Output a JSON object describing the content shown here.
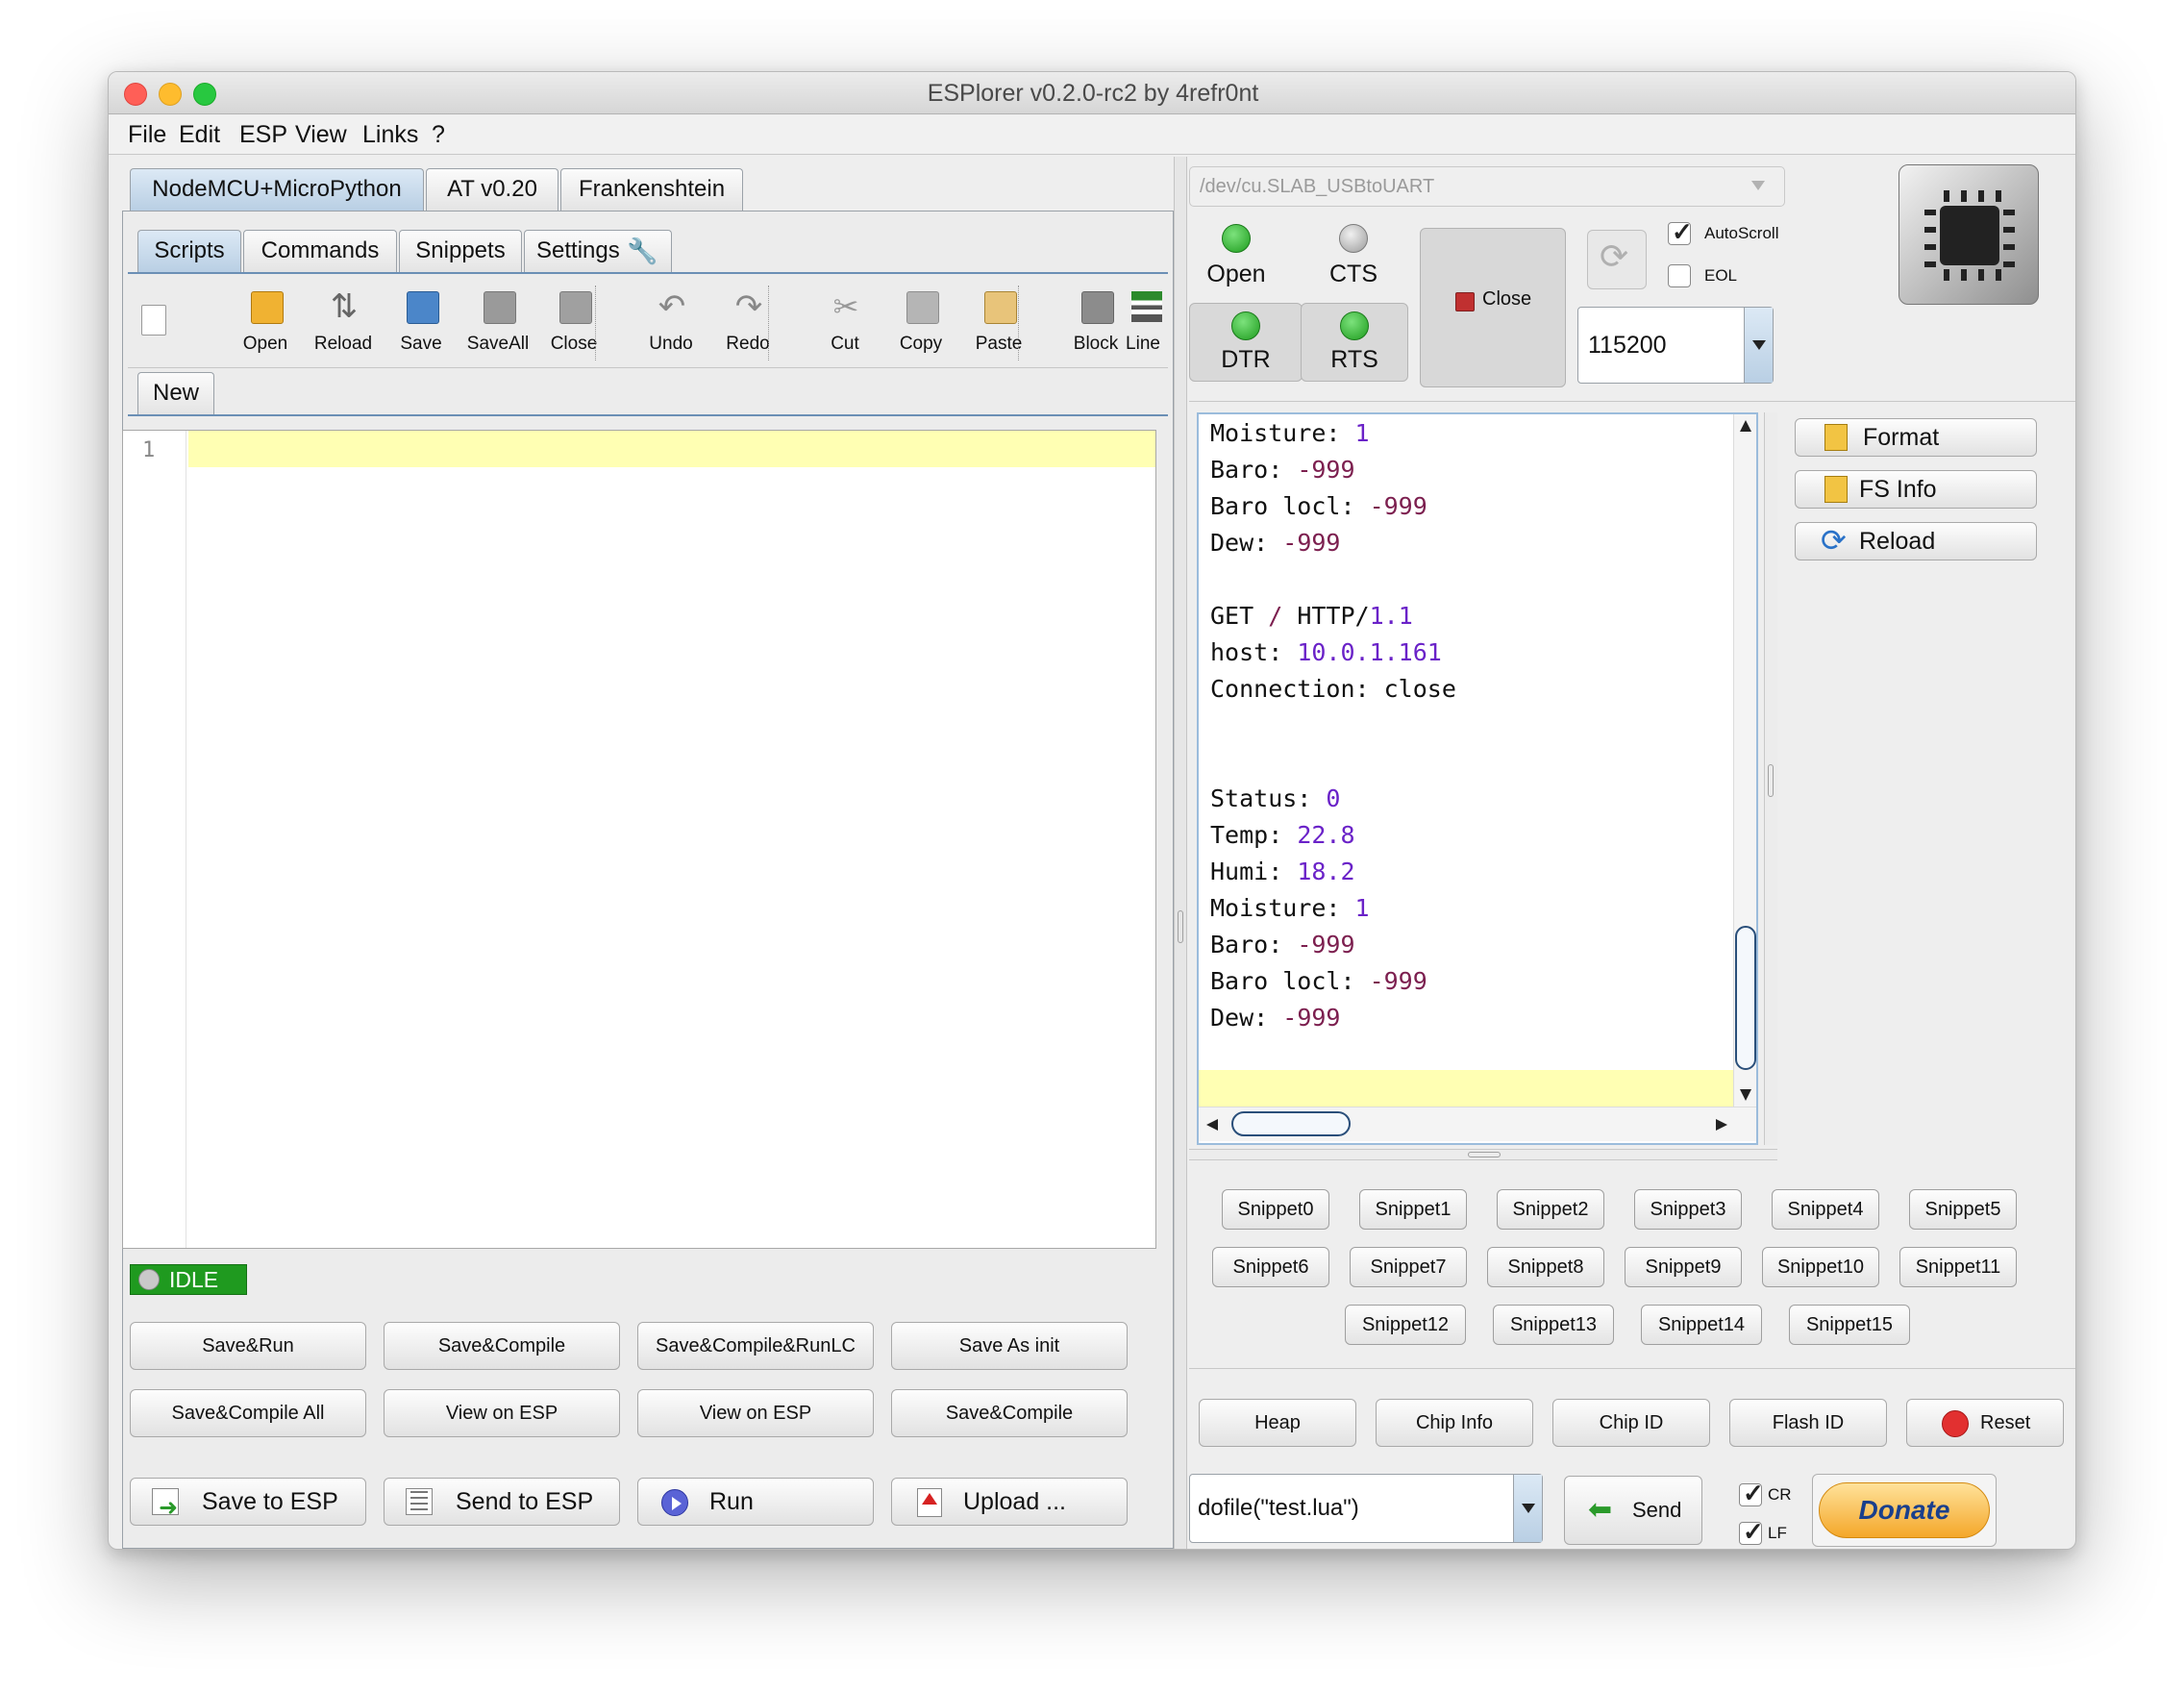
{
  "window": {
    "title": "ESPlorer v0.2.0-rc2 by 4refr0nt"
  },
  "menu": [
    "File",
    "Edit",
    "ESP",
    "View",
    "Links",
    "?"
  ],
  "firmware_tabs": [
    "NodeMCU+MicroPython",
    "AT v0.20",
    "Frankenshtein"
  ],
  "sub_tabs": [
    "Scripts",
    "Commands",
    "Snippets",
    "Settings"
  ],
  "toolbar": [
    "Open",
    "Reload",
    "Save",
    "SaveAll",
    "Close",
    "Undo",
    "Redo",
    "Cut",
    "Copy",
    "Paste",
    "Block",
    "Line"
  ],
  "file_tab": "New",
  "editor": {
    "line_number": "1"
  },
  "status": "IDLE",
  "script_buttons": [
    "Save&Run",
    "Save&Compile",
    "Save&Compile&RunLC",
    "Save As init",
    "Save&Compile All",
    "View on ESP",
    "View on ESP",
    "Save&Compile"
  ],
  "action_buttons": [
    "Save to ESP",
    "Send to ESP",
    "Run",
    "Upload ..."
  ],
  "port": {
    "value": "/dev/cu.SLAB_USBtoUART"
  },
  "signals": [
    "Open",
    "CTS",
    "DTR",
    "RTS"
  ],
  "close_label": "Close",
  "options": [
    "AutoScroll",
    "EOL"
  ],
  "baud": "115200",
  "terminal_lines": [
    [
      "Moisture: ",
      "1",
      "num"
    ],
    [
      "Baro: ",
      "-999",
      "neg"
    ],
    [
      "Baro locl: ",
      "-999",
      "neg"
    ],
    [
      "Dew: ",
      "-999",
      "neg"
    ],
    [
      "",
      "",
      ""
    ],
    [
      "GET / HTTP/",
      "1.1",
      "num"
    ],
    [
      "host: ",
      "10.0.1.161",
      "num"
    ],
    [
      "Connection: close",
      "",
      ""
    ],
    [
      "",
      "",
      ""
    ],
    [
      "",
      "",
      ""
    ],
    [
      "Status: ",
      "0",
      "num"
    ],
    [
      "Temp: ",
      "22.8",
      "num"
    ],
    [
      "Humi: ",
      "18.2",
      "num"
    ],
    [
      "Moisture: ",
      "1",
      "num"
    ],
    [
      "Baro: ",
      "-999",
      "neg"
    ],
    [
      "Baro locl: ",
      "-999",
      "neg"
    ],
    [
      "Dew: ",
      "-999",
      "neg"
    ]
  ],
  "side_buttons": [
    "Format",
    "FS Info",
    "Reload"
  ],
  "snippets": [
    "Snippet0",
    "Snippet1",
    "Snippet2",
    "Snippet3",
    "Snippet4",
    "Snippet5",
    "Snippet6",
    "Snippet7",
    "Snippet8",
    "Snippet9",
    "Snippet10",
    "Snippet11",
    "Snippet12",
    "Snippet13",
    "Snippet14",
    "Snippet15"
  ],
  "bottom_buttons": [
    "Heap",
    "Chip Info",
    "Chip ID",
    "Flash ID",
    "Reset"
  ],
  "command": {
    "value": "dofile(\"test.lua\")",
    "send_label": "Send"
  },
  "line_endings": [
    "CR",
    "LF"
  ],
  "donate": "Donate",
  "colors": {
    "accent": "#b9cfe4",
    "status_green": "#22aa22",
    "current_line": "#ffffb3",
    "number": "#6a22c8",
    "negative": "#7c1f4f"
  }
}
